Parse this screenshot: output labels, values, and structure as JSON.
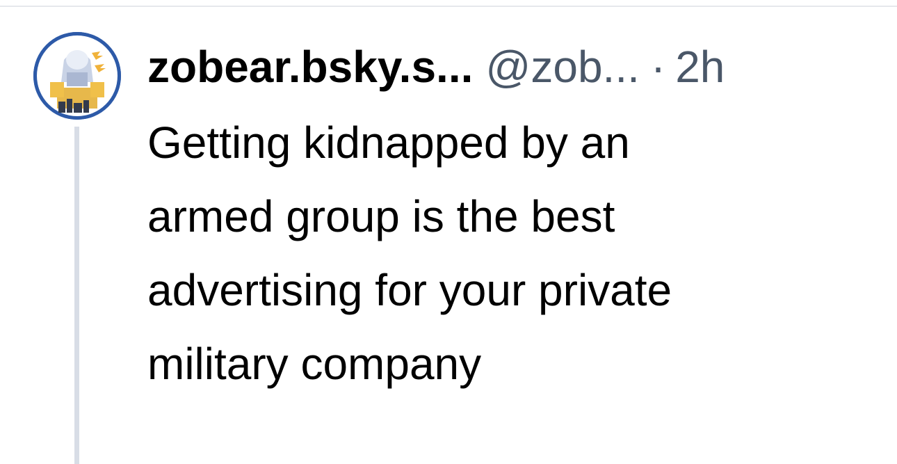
{
  "post": {
    "author": {
      "display_name": "zobear.bsky.s...",
      "handle": "@zob...",
      "avatar_icon": "profile-avatar-image"
    },
    "separator": "·",
    "timestamp": "2h",
    "text_lines": [
      "Getting kidnapped by an",
      "armed group is the best",
      "advertising for your private",
      "military company"
    ]
  },
  "colors": {
    "handle_text": "#4a5768",
    "thread_line": "#d8dde6",
    "avatar_background": "#2d5aa8"
  }
}
